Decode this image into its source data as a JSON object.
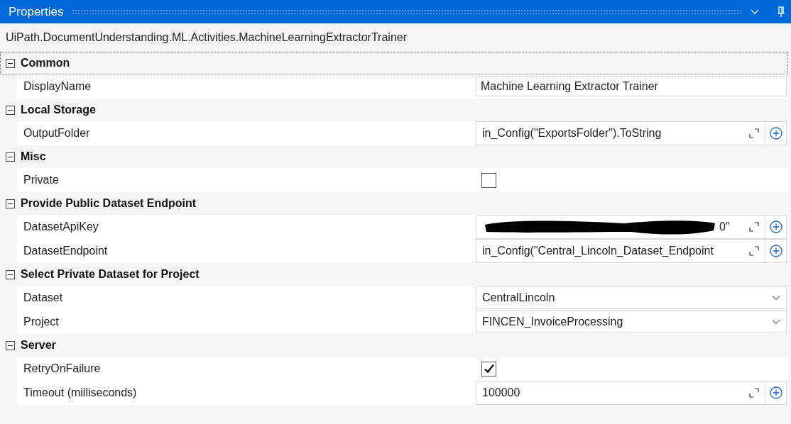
{
  "window": {
    "title": "Properties"
  },
  "type_name": "UiPath.DocumentUnderstanding.ML.Activities.MachineLearningExtractorTrainer",
  "categories": [
    {
      "name": "Common",
      "expanded": true,
      "focused": true,
      "properties": [
        {
          "name": "DisplayName",
          "kind": "text",
          "value": "Machine Learning Extractor Trainer"
        }
      ]
    },
    {
      "name": "Local Storage",
      "expanded": true,
      "focused": false,
      "properties": [
        {
          "name": "OutputFolder",
          "kind": "expression",
          "value": "in_Config(\"ExportsFolder\").ToString"
        }
      ]
    },
    {
      "name": "Misc",
      "expanded": true,
      "focused": false,
      "properties": [
        {
          "name": "Private",
          "kind": "checkbox",
          "checked": false
        }
      ]
    },
    {
      "name": "Provide Public Dataset Endpoint",
      "expanded": true,
      "focused": false,
      "properties": [
        {
          "name": "DatasetApiKey",
          "kind": "expression",
          "redacted": true,
          "value": "0\""
        },
        {
          "name": "DatasetEndpoint",
          "kind": "expression",
          "value": "in_Config(\"Central_Lincoln_Dataset_Endpoint"
        }
      ]
    },
    {
      "name": "Select Private Dataset for Project",
      "expanded": true,
      "focused": false,
      "properties": [
        {
          "name": "Dataset",
          "kind": "dropdown",
          "value": "CentralLincoln"
        },
        {
          "name": "Project",
          "kind": "dropdown",
          "value": "FINCEN_InvoiceProcessing"
        }
      ]
    },
    {
      "name": "Server",
      "expanded": true,
      "focused": false,
      "properties": [
        {
          "name": "RetryOnFailure",
          "kind": "checkbox",
          "checked": true
        },
        {
          "name": "Timeout (milliseconds)",
          "kind": "expression",
          "value": "100000"
        }
      ]
    }
  ]
}
